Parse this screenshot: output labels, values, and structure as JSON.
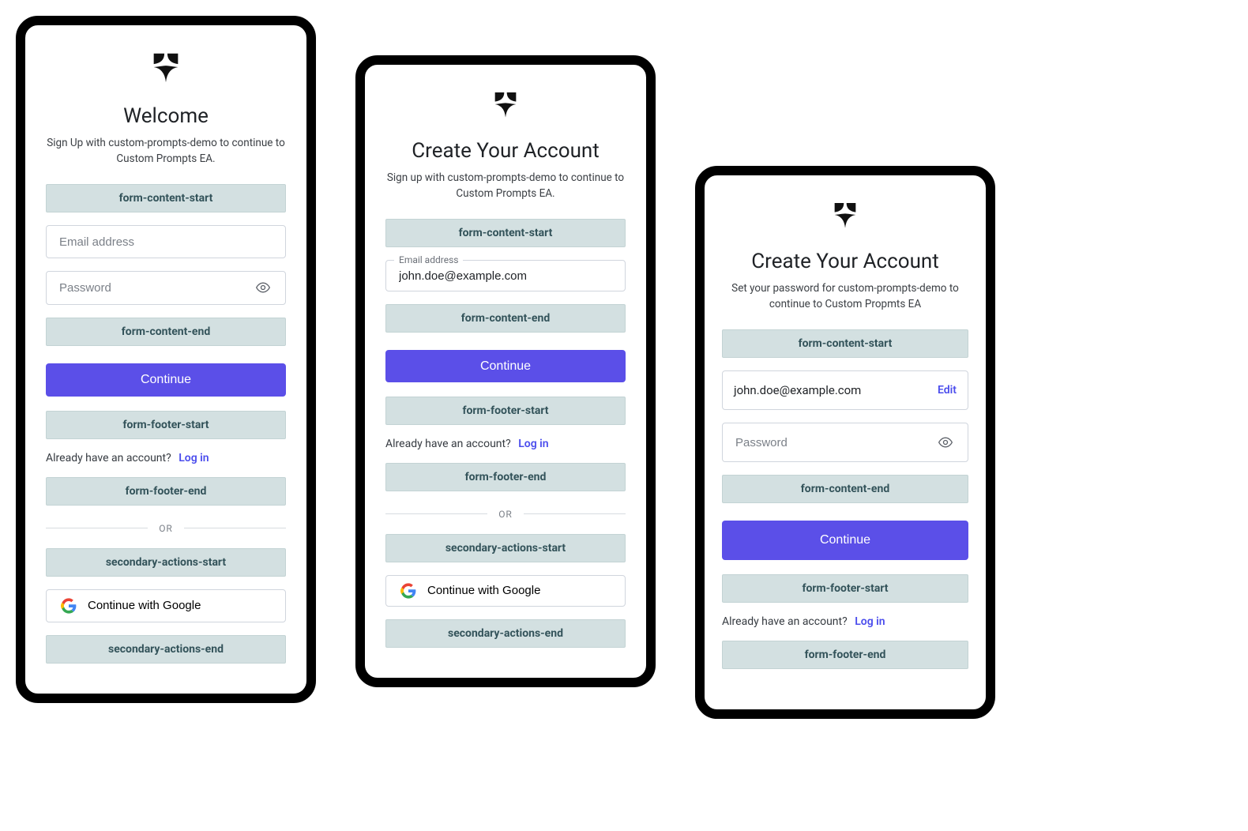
{
  "colors": {
    "accent": "#5B4FE8",
    "badge_bg": "#D3E0E1",
    "badge_fg": "#33535A",
    "link": "#4B4DED"
  },
  "badges": {
    "form_content_start": "form-content-start",
    "form_content_end": "form-content-end",
    "form_footer_start": "form-footer-start",
    "form_footer_end": "form-footer-end",
    "secondary_actions_start": "secondary-actions-start",
    "secondary_actions_end": "secondary-actions-end"
  },
  "common": {
    "continue": "Continue",
    "already": "Already have an account?",
    "login": "Log in",
    "or": "OR",
    "google": "Continue with Google",
    "edit": "Edit",
    "email_placeholder": "Email address",
    "password_placeholder": "Password"
  },
  "panel1": {
    "title": "Welcome",
    "subtitle": "Sign Up with custom-prompts-demo to continue to Custom Prompts EA."
  },
  "panel2": {
    "title": "Create Your Account",
    "subtitle": "Sign up with custom-prompts-demo to continue to Custom Prompts EA.",
    "email_label": "Email address",
    "email_value": "john.doe@example.com"
  },
  "panel3": {
    "title": "Create Your Account",
    "subtitle": "Set your password for custom-prompts-demo to continue to Custom Propmts EA",
    "email_value": "john.doe@example.com"
  }
}
